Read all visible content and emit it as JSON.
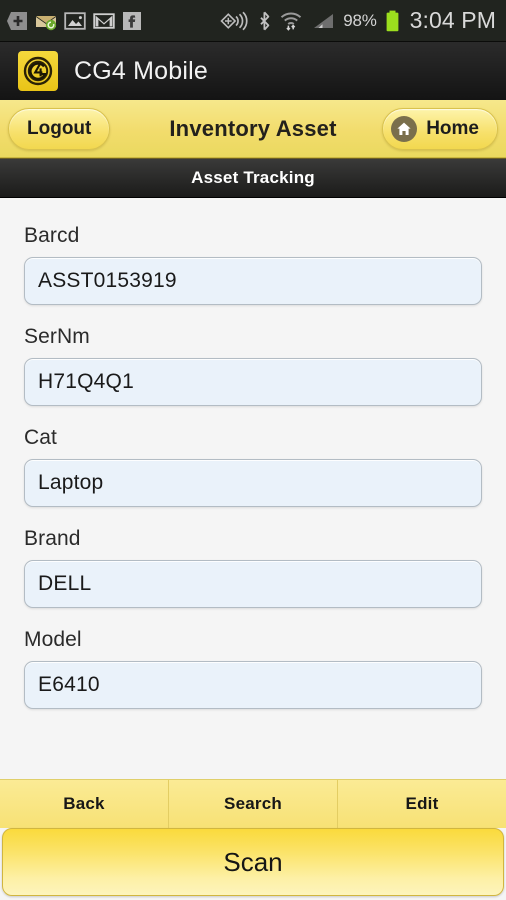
{
  "statusbar": {
    "icons_left": [
      "add-widget-icon",
      "email-envelope-icon",
      "gallery-image-icon",
      "gmail-icon",
      "facebook-icon"
    ],
    "icons_right": [
      "nfc-beam-icon",
      "bluetooth-icon",
      "wifi-signal-icon",
      "cellular-signal-icon"
    ],
    "battery_percent": "98%",
    "battery_icon": "battery-full-icon",
    "clock": "3:04 PM"
  },
  "appbar": {
    "logo": "cg4-logo-icon",
    "title": "CG4 Mobile"
  },
  "navbar": {
    "logout_label": "Logout",
    "title": "Inventory Asset",
    "home_label": "Home",
    "home_icon": "home-icon"
  },
  "subheader": {
    "title": "Asset Tracking"
  },
  "form": {
    "fields": [
      {
        "label": "Barcd",
        "value": "ASST0153919",
        "name": "barcode"
      },
      {
        "label": "SerNm",
        "value": "H71Q4Q1",
        "name": "serial-number"
      },
      {
        "label": "Cat",
        "value": "Laptop",
        "name": "category"
      },
      {
        "label": "Brand",
        "value": "DELL",
        "name": "brand"
      },
      {
        "label": "Model",
        "value": "E6410",
        "name": "model"
      }
    ]
  },
  "buttonbar": {
    "items": [
      {
        "label": "Back"
      },
      {
        "label": "Search"
      },
      {
        "label": "Edit"
      }
    ]
  },
  "scan": {
    "label": "Scan"
  },
  "colors": {
    "accent_yellow": "#f2dc6c",
    "nav_yellow_light": "#fdf4ab",
    "scan_gold": "#fada3c",
    "input_fill": "#eaf2fa",
    "dark_bar": "#1b1b1a",
    "battery_green": "#9cdf1e"
  }
}
